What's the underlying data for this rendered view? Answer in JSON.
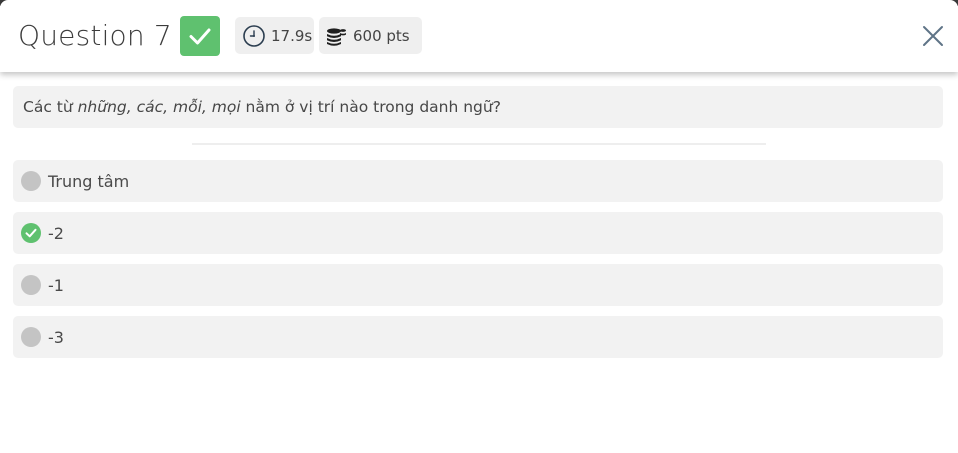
{
  "header": {
    "title": "Question 7",
    "status": "correct",
    "time_label": "17.9s",
    "points_label": "600 pts"
  },
  "question": {
    "prefix": "Các từ ",
    "italic": "những, các, mỗi, mọi",
    "suffix": " nằm ở vị trí nào trong danh ngữ?"
  },
  "options": [
    {
      "label": "Trung tâm",
      "state": "unselected"
    },
    {
      "label": "-2",
      "state": "correct"
    },
    {
      "label": "-1",
      "state": "unselected"
    },
    {
      "label": "-3",
      "state": "unselected"
    }
  ],
  "colors": {
    "accent_green": "#5fc16f",
    "panel_bg": "#f2f2f2",
    "radio_gray": "#c4c4c4",
    "close_icon": "#5f7487"
  },
  "icons": {
    "status": "check-icon",
    "time": "clock-icon",
    "points": "coins-icon",
    "close": "close-icon"
  }
}
